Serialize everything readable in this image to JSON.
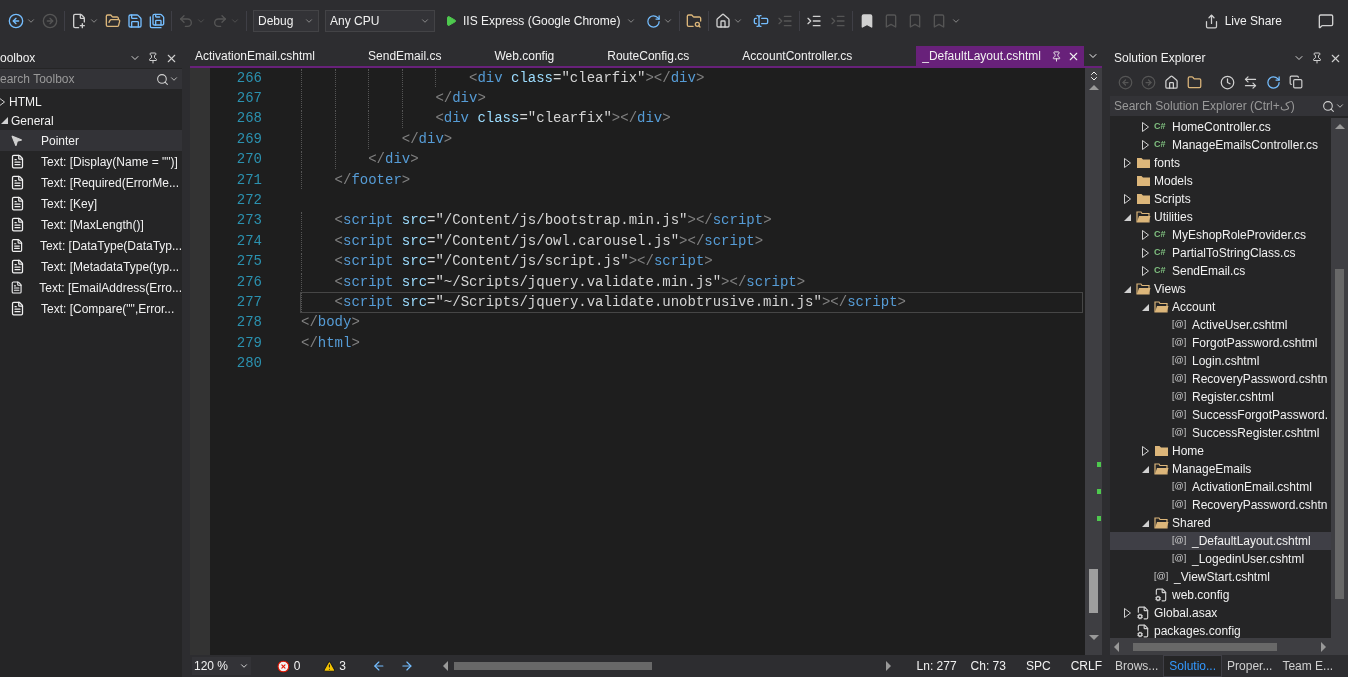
{
  "toolbar": {
    "configuration": "Debug",
    "platform": "Any CPU",
    "run_target": "IIS Express (Google Chrome)",
    "live_share": "Live Share"
  },
  "toolbox": {
    "title": "oolbox",
    "search_placeholder": "earch Toolbox",
    "groups": [
      {
        "label": "HTML",
        "expanded": false
      },
      {
        "label": "General",
        "expanded": true,
        "items": [
          {
            "label": "Pointer",
            "kind": "pointer",
            "selected": true
          },
          {
            "label": "Text: [Display(Name = \"\")]",
            "kind": "text",
            "selected": false
          },
          {
            "label": "Text: [Required(ErrorMe...",
            "kind": "text",
            "selected": false
          },
          {
            "label": "Text: [Key]",
            "kind": "text",
            "selected": false
          },
          {
            "label": "Text: [MaxLength()]",
            "kind": "text",
            "selected": false
          },
          {
            "label": "Text: [DataType(DataTyp...",
            "kind": "text",
            "selected": false
          },
          {
            "label": "Text: [MetadataType(typ...",
            "kind": "text",
            "selected": false
          },
          {
            "label": "Text: [EmailAddress(Erro...",
            "kind": "text",
            "selected": false
          },
          {
            "label": "Text: [Compare(\"\",Error...",
            "kind": "text",
            "selected": false
          }
        ]
      }
    ]
  },
  "editor_tabs": [
    {
      "label": "ActivationEmail.cshtml",
      "selected": false
    },
    {
      "label": "SendEmail.cs",
      "selected": false
    },
    {
      "label": "Web.config",
      "selected": false
    },
    {
      "label": "RouteConfig.cs",
      "selected": false
    },
    {
      "label": "AccountController.cs",
      "selected": false
    },
    {
      "label": "_DefaultLayout.cshtml",
      "selected": true
    }
  ],
  "code_lines": [
    {
      "number": "266",
      "code": "                    <div class=\"clearfix\"></div>",
      "current": false
    },
    {
      "number": "267",
      "code": "                </div>",
      "current": false
    },
    {
      "number": "268",
      "code": "                <div class=\"clearfix\"></div>",
      "current": false
    },
    {
      "number": "269",
      "code": "            </div>",
      "current": false
    },
    {
      "number": "270",
      "code": "        </div>",
      "current": false
    },
    {
      "number": "271",
      "code": "    </footer>",
      "current": false
    },
    {
      "number": "272",
      "current": false
    },
    {
      "number": "273",
      "code": "    <script src=\"/Content/js/bootstrap.min.js\"></script>",
      "current": false
    },
    {
      "number": "274",
      "code": "    <script src=\"/Content/js/owl.carousel.js\"></script>",
      "current": false
    },
    {
      "number": "275",
      "code": "    <script src=\"/Content/js/script.js\"></script>",
      "current": false
    },
    {
      "number": "276",
      "code": "    <script src=\"~/Scripts/jquery.validate.min.js\"></script>",
      "current": false
    },
    {
      "number": "277",
      "code": "    <script src=\"~/Scripts/jquery.validate.unobtrusive.min.js\"></script>",
      "current": true
    },
    {
      "number": "278",
      "code": "</body>",
      "current": false
    },
    {
      "number": "279",
      "code": "</html>",
      "current": false
    },
    {
      "number": "280",
      "current": false
    }
  ],
  "editor_status": {
    "zoom": "120 %",
    "errors": "0",
    "warnings": "3",
    "line": "Ln: 277",
    "column": "Ch: 73",
    "indent_mode": "SPC",
    "line_endings": "CRLF"
  },
  "solution_explorer": {
    "title": "Solution Explorer",
    "search_placeholder": "Search Solution Explorer (Ctrl+ک)",
    "tree_continued": [
      {
        "label": "HomeController.cs",
        "kind": "cs",
        "icon_text": "C#",
        "expanded": false,
        "selected": false
      },
      {
        "label": "ManageEmailsController.cs",
        "kind": "cs",
        "icon_text": "C#",
        "expanded": false,
        "selected": false
      }
    ],
    "tree": [
      {
        "label": "fonts",
        "kind": "folder",
        "expanded": false,
        "selected": false
      },
      {
        "label": "Models",
        "kind": "folder",
        "selected": false
      },
      {
        "label": "Scripts",
        "kind": "folder",
        "expanded": false,
        "selected": false
      },
      {
        "label": "Utilities",
        "kind": "folder",
        "expanded": true,
        "selected": false,
        "children": [
          {
            "label": "MyEshopRoleProvider.cs",
            "kind": "cs",
            "icon_text": "C#",
            "expanded": false,
            "selected": false
          },
          {
            "label": "PartialToStringClass.cs",
            "kind": "cs",
            "icon_text": "C#",
            "expanded": false,
            "selected": false
          },
          {
            "label": "SendEmail.cs",
            "kind": "cs",
            "icon_text": "C#",
            "expanded": false,
            "selected": false
          }
        ]
      },
      {
        "label": "Views",
        "kind": "folder",
        "expanded": true,
        "selected": false,
        "children": [
          {
            "label": "Account",
            "kind": "folder",
            "expanded": true,
            "selected": false,
            "children": [
              {
                "label": "ActiveUser.cshtml",
                "kind": "cshtml",
                "icon_text": "[@]",
                "selected": false
              },
              {
                "label": "ForgotPassword.cshtml",
                "kind": "cshtml",
                "icon_text": "[@]",
                "selected": false
              },
              {
                "label": "Login.cshtml",
                "kind": "cshtml",
                "icon_text": "[@]",
                "selected": false
              },
              {
                "label": "RecoveryPassword.cshtn",
                "kind": "cshtml",
                "icon_text": "[@]",
                "selected": false
              },
              {
                "label": "Register.cshtml",
                "kind": "cshtml",
                "icon_text": "[@]",
                "selected": false
              },
              {
                "label": "SuccessForgotPassword.",
                "kind": "cshtml",
                "icon_text": "[@]",
                "selected": false
              },
              {
                "label": "SuccessRegister.cshtml",
                "kind": "cshtml",
                "icon_text": "[@]",
                "selected": false
              }
            ]
          },
          {
            "label": "Home",
            "kind": "folder",
            "expanded": false,
            "selected": false
          },
          {
            "label": "ManageEmails",
            "kind": "folder",
            "expanded": true,
            "selected": false,
            "children": [
              {
                "label": "ActivationEmail.cshtml",
                "kind": "cshtml",
                "icon_text": "[@]",
                "selected": false
              },
              {
                "label": "RecoveryPassword.cshtn",
                "kind": "cshtml",
                "icon_text": "[@]",
                "selected": false
              }
            ]
          },
          {
            "label": "Shared",
            "kind": "folder",
            "expanded": true,
            "selected": false,
            "children": [
              {
                "label": "_DefaultLayout.cshtml",
                "kind": "cshtml",
                "icon_text": "[@]",
                "selected": true
              },
              {
                "label": "_LogedinUser.cshtml",
                "kind": "cshtml",
                "icon_text": "[@]",
                "selected": false
              }
            ]
          },
          {
            "label": "_ViewStart.cshtml",
            "kind": "cshtml",
            "icon_text": "[@]",
            "selected": false
          },
          {
            "label": "web.config",
            "kind": "config",
            "selected": false
          }
        ]
      },
      {
        "label": "Global.asax",
        "kind": "asax",
        "expanded": false,
        "selected": false
      },
      {
        "label": "packages.config",
        "kind": "config",
        "selected": false
      }
    ],
    "bottom_tabs": [
      {
        "label": "Brows...",
        "selected": false
      },
      {
        "label": "Solutio...",
        "selected": true
      },
      {
        "label": "Proper...",
        "selected": false
      },
      {
        "label": "Team E...",
        "selected": false
      }
    ]
  }
}
